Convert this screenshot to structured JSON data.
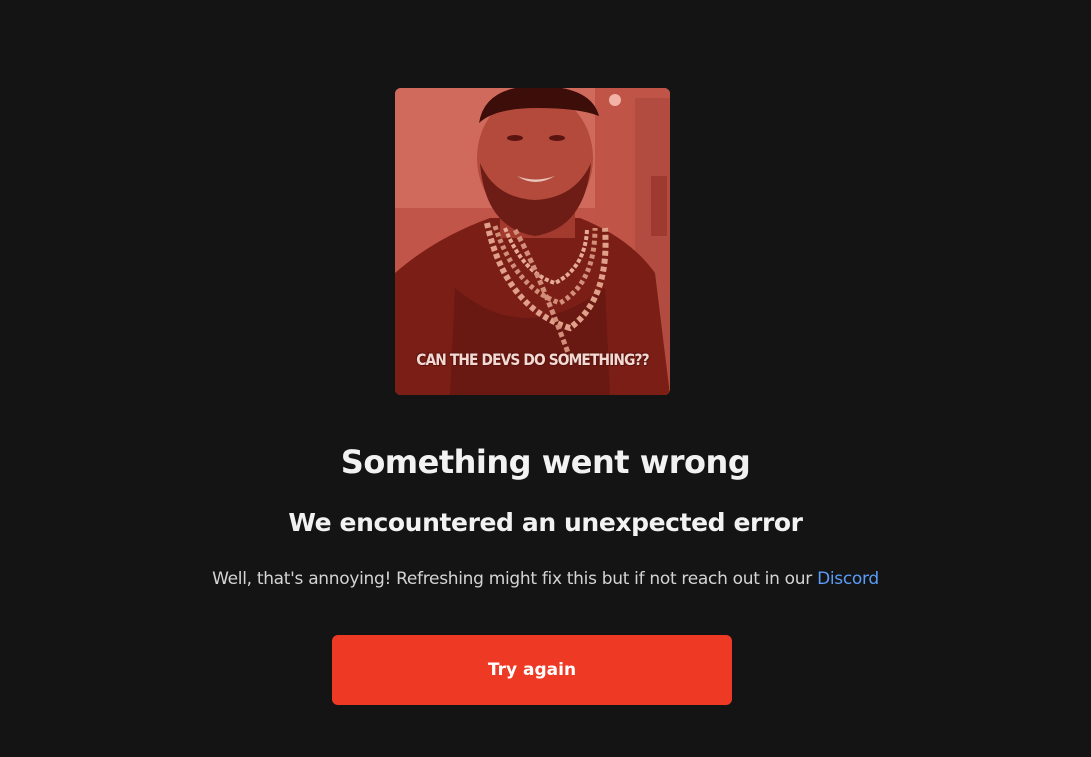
{
  "error": {
    "image": {
      "caption": "CAN THE DEVS DO SOMETHING??"
    },
    "title": "Something went wrong",
    "subtitle": "We encountered an unexpected error",
    "message": "Well, that's annoying! Refreshing might fix this but if not reach out in our ",
    "link_label": "Discord",
    "button_label": "Try again"
  },
  "colors": {
    "background": "#141414",
    "accent": "#ee3a24",
    "link": "#5a9cf8",
    "text": "#f2f2f2"
  }
}
